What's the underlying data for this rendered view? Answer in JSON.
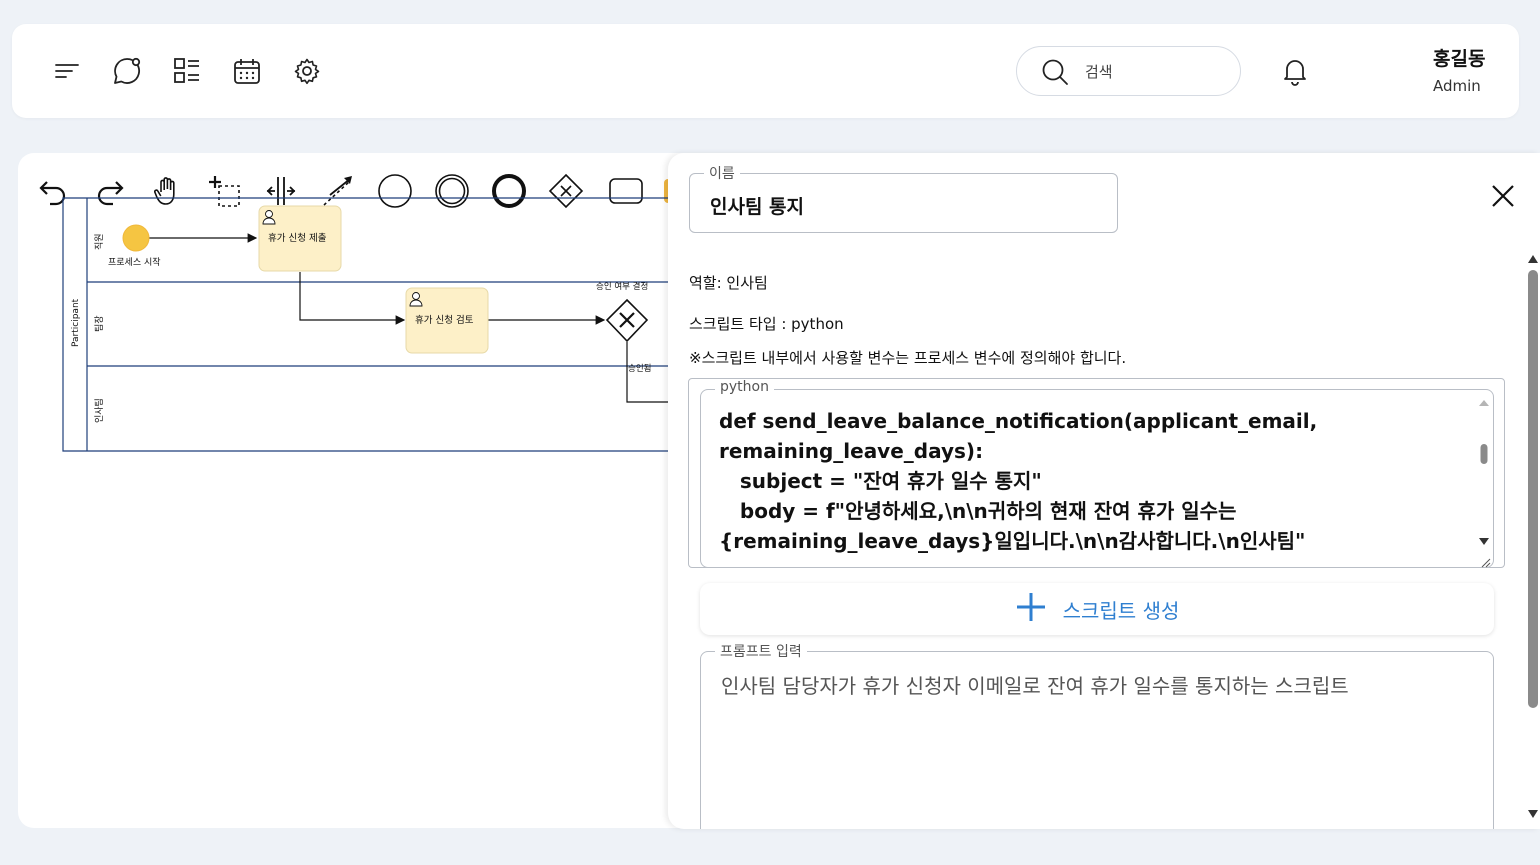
{
  "header": {
    "search_placeholder": "검색",
    "user_name": "홍길동",
    "user_role": "Admin"
  },
  "diagram": {
    "pool_label": "Participant",
    "lanes": [
      "직원",
      "팀장",
      "인사팀"
    ],
    "start_event_label": "프로세스 시작",
    "task_submit": "휴가 신청 제출",
    "task_review": "휴가 신청 검토",
    "gateway_label": "승인 여부 결정",
    "flow_approved": "승인됨"
  },
  "panel": {
    "name_legend": "이름",
    "name_value": "인사팀 통지",
    "role_line": "역할: 인사팀",
    "script_type_line": "스크립트 타입 : python",
    "note_line": "※스크립트 내부에서 사용할 변수는 프로세스 변수에 정의해야 합니다.",
    "code_legend": "python",
    "code_text": "def send_leave_balance_notification(applicant_email,\nremaining_leave_days):\n   subject = \"잔여 휴가 일수 통지\"\n   body = f\"안녕하세요,\\n\\n귀하의 현재 잔여 휴가 일수는\n{remaining_leave_days}일입니다.\\n\\n감사합니다.\\n인사팀\"",
    "generate_button": "스크립트 생성",
    "prompt_legend": "프롬프트 입력",
    "prompt_value": "인사팀 담당자가 휴가 신청자 이메일로 잔여 휴가 일수를 통지하는 스크립트"
  },
  "colors": {
    "accent": "#2f7fd0",
    "task_fill": "#fdf0c8",
    "start_event": "#f5c542",
    "lane_border": "#1f3f7a"
  }
}
